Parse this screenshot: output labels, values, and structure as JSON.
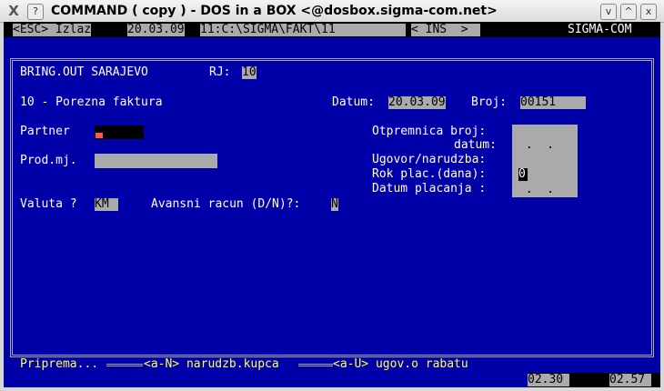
{
  "window": {
    "title": "COMMAND ( copy ) - DOS in a BOX  <@dosbox.sigma-com.net>",
    "icon": "X",
    "buttons": [
      "?",
      "^",
      "v",
      "x"
    ]
  },
  "status": {
    "esc": "<ESC> Izlaz",
    "date": "20.03.09",
    "path": "11:C:\\SIGMA\\FAKT\\11",
    "ins": "< INS  >",
    "company": "SIGMA-COM"
  },
  "form": {
    "firm": "BRING.OUT SARAJEVO",
    "rj_label": "RJ:",
    "rj_value": "10",
    "doc_type": "10 - Porezna faktura",
    "datum_label": "Datum:",
    "datum_value": "20.03.09",
    "broj_label": "Broj:",
    "broj_value": "00151",
    "partner_label": "Partner",
    "prodmj_label": "Prod.mj.",
    "otpremnica_label": "Otpremnica broj:",
    "otp_datum_label": "datum:",
    "otp_datum_value": " .  .",
    "ugovor_label": "Ugovor/narudzba:",
    "rok_label": "Rok plac.(dana):",
    "rok_value": "0",
    "datum_plac_label": "Datum placanja :",
    "datum_plac_value": " .  .",
    "valuta_label": "Valuta ?",
    "valuta_value": "KM",
    "avans_label": "Avansni racun (D/N)?:",
    "avans_value": "N"
  },
  "footer": {
    "priprema": "Priprema...",
    "narudzba": "<a-N> narudzb.kupca",
    "ugovor": "<a-U> ugov.o rabatu",
    "time1": "02.30",
    "time2": "02.57"
  }
}
